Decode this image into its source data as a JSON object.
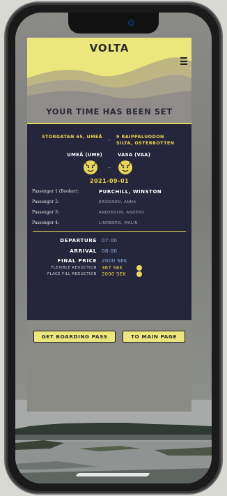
{
  "app": {
    "logo": "VOLTA",
    "page_title": "YOUR TIME HAS BEEN SET"
  },
  "trip": {
    "from_address": "STORGATAN 65, UMEÅ",
    "to_address": "9 RAIPPALUODON SILTA, OSTERBOTTEN",
    "from_code": "UMEÅ (UME)",
    "to_code": "VASA (VAA)",
    "separator": "–",
    "date": "2021-09-01"
  },
  "passengers": [
    {
      "label": "Passenger 1 (Booker):",
      "name": "PURCHILL, WINSTON"
    },
    {
      "label": "Passenger 2:",
      "name": "ERIKSSON, ANNA"
    },
    {
      "label": "Passenger 3:",
      "name": "ANDERSON, ANDERS"
    },
    {
      "label": "Passenger 4:",
      "name": "LINDBERG, MALIN"
    }
  ],
  "schedule": {
    "departure_label": "DEPARTURE",
    "departure_time": "07:00",
    "arrival_label": "ARRIVAL",
    "arrival_time": "08:00",
    "price_label": "FINAL PRICE",
    "price_value": "2000 SEK",
    "flexible_label": "FLEXIBLE REDUCTION",
    "flexible_value": "367 SEK",
    "placefill_label": "PLACE FILL REDUCTION",
    "placefill_value": "2000 SEK"
  },
  "actions": {
    "boarding_pass": "GET BOARDING PASS",
    "main_page": "TO MAIN PAGE"
  },
  "colors": {
    "header_yellow": "#ece77c",
    "card_navy": "#25253b",
    "accent_gold": "#efd64d",
    "time_blue": "#8fb0e8"
  },
  "icons": {
    "menu": "hamburger-menu-icon",
    "face": "face-emblem-icon",
    "info": "info-dot-icon"
  }
}
